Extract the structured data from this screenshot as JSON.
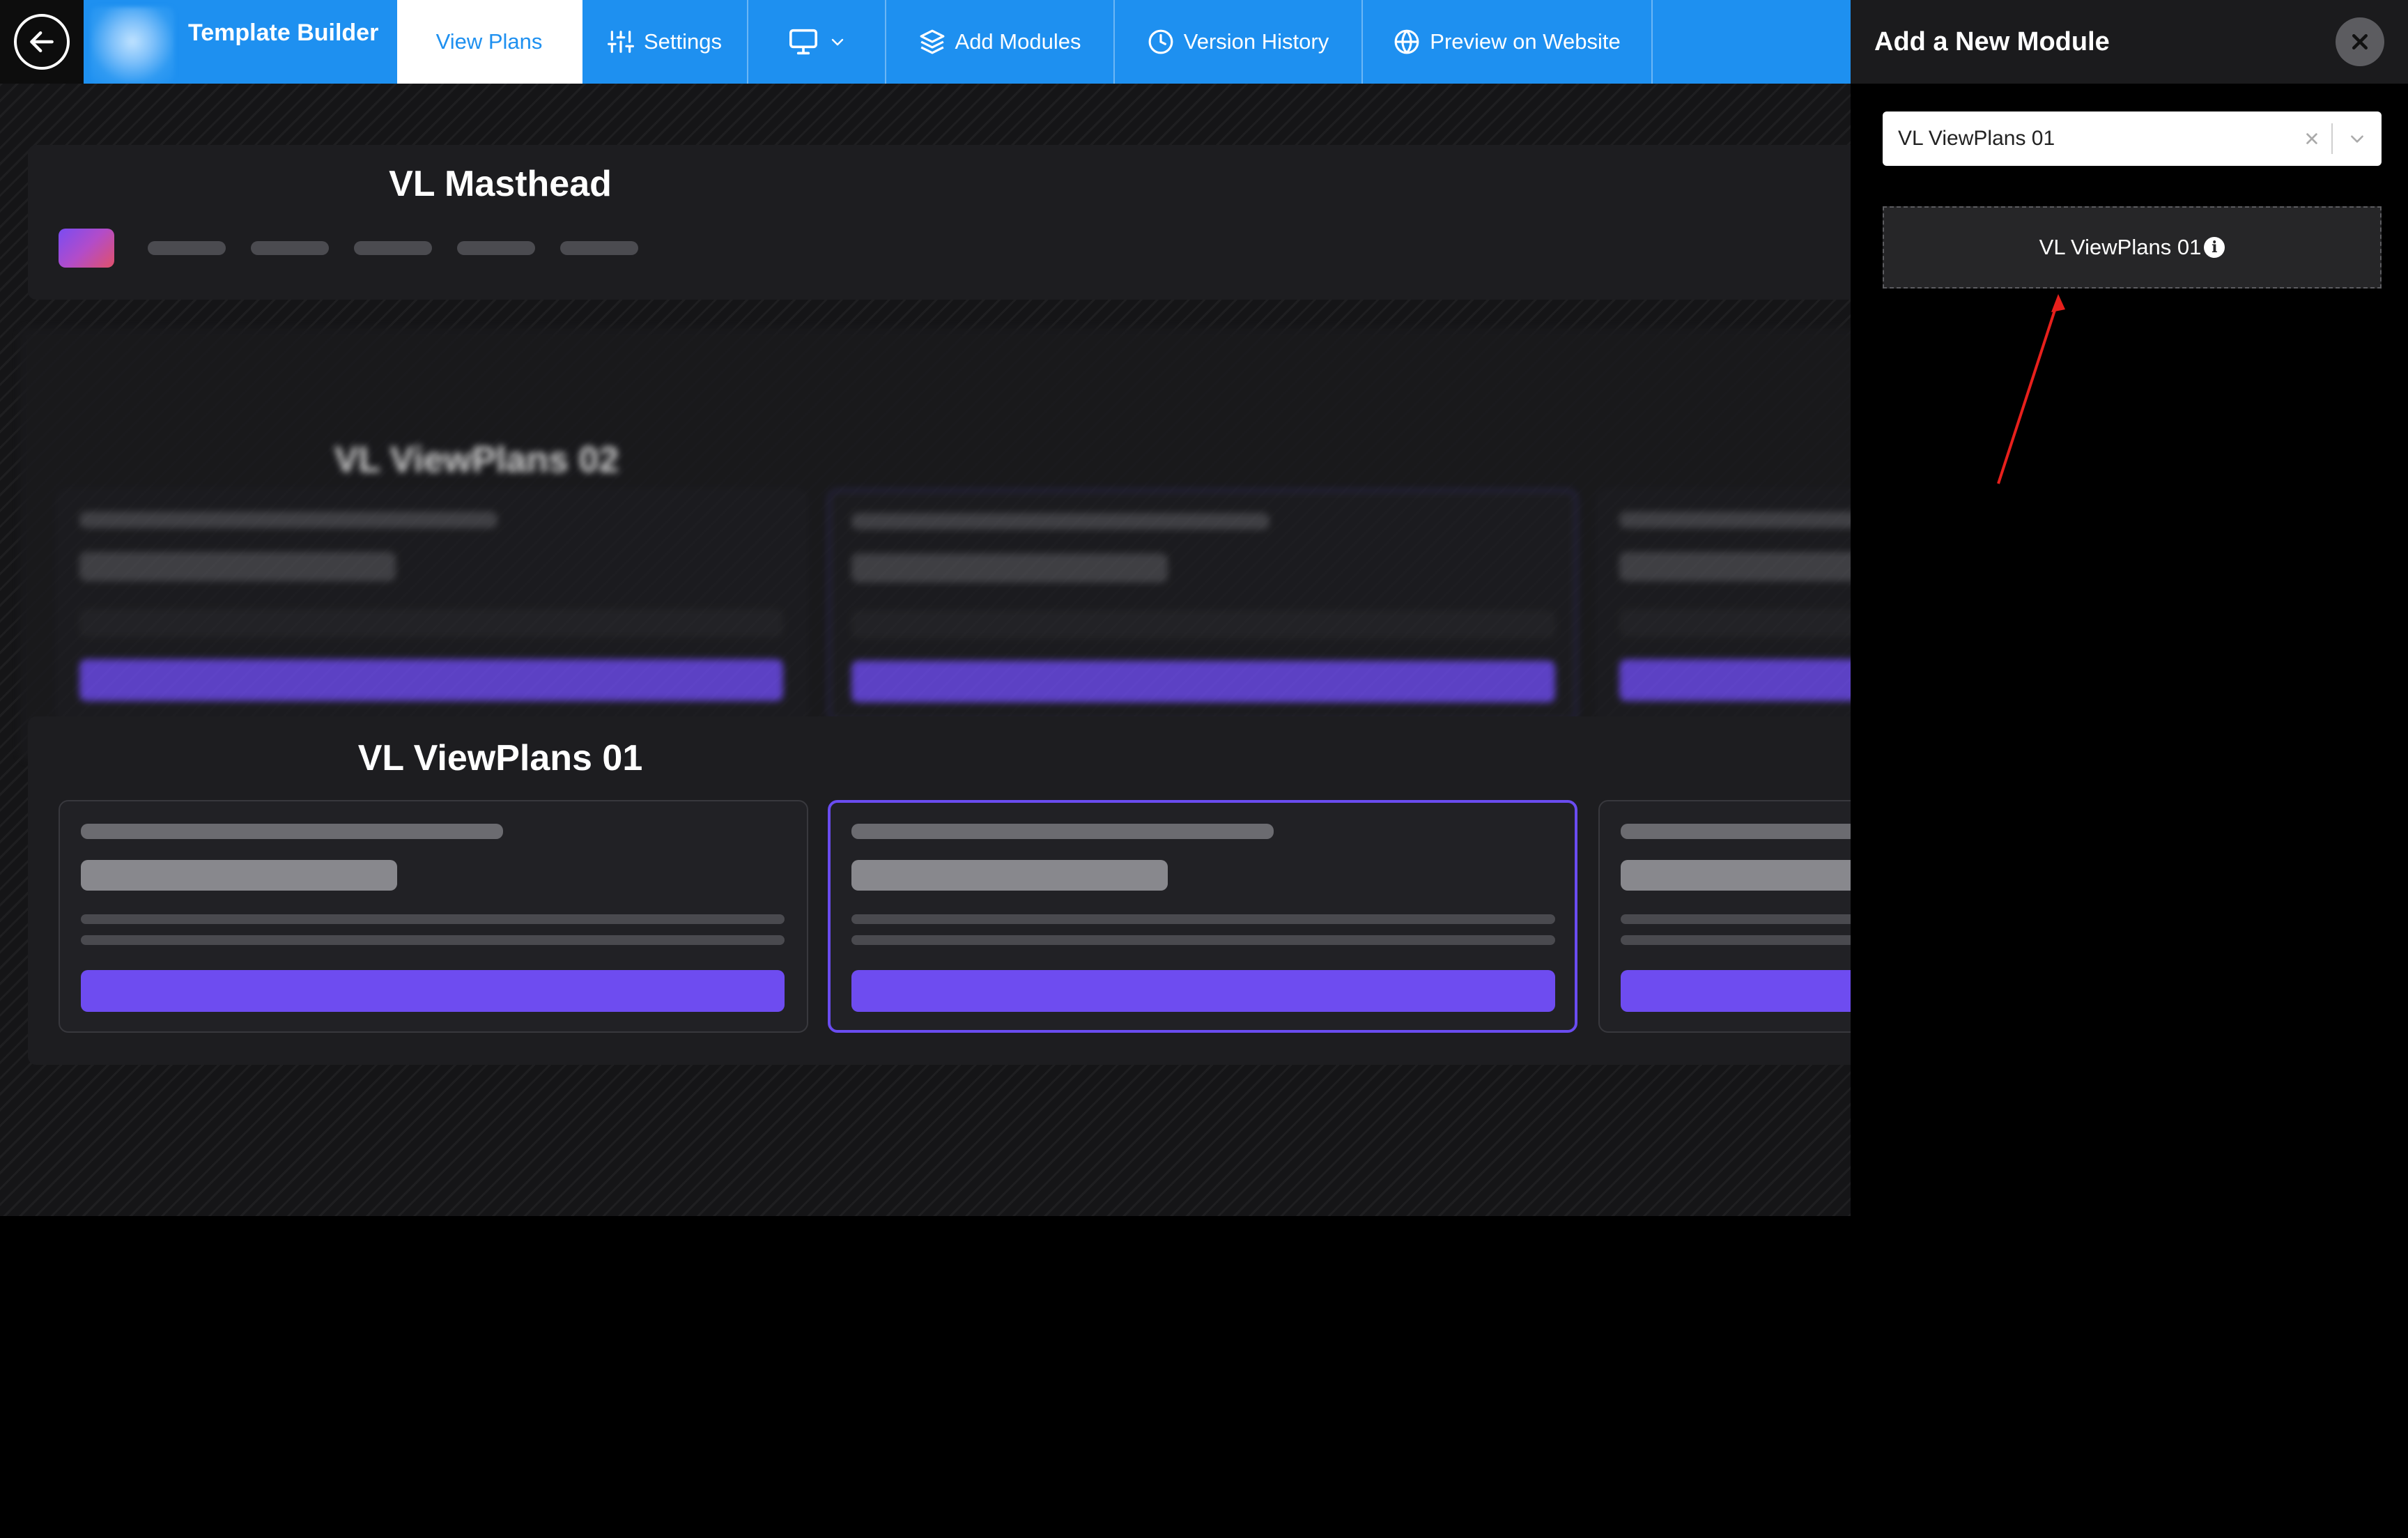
{
  "header": {
    "title": "Template Builder",
    "tabs": [
      {
        "label": "View Plans",
        "active": true
      },
      {
        "label": "Settings",
        "icon": "sliders-icon"
      },
      {
        "label": "",
        "icon": "monitor-icon"
      },
      {
        "label": "Add Modules",
        "icon": "layers-icon"
      },
      {
        "label": "Version History",
        "icon": "clock-icon"
      },
      {
        "label": "Preview on Website",
        "icon": "globe-icon"
      }
    ]
  },
  "canvas": {
    "modules": [
      {
        "title": "VL Masthead"
      },
      {
        "title": "VL ViewPlans 02"
      },
      {
        "title": "VL ViewPlans 01"
      }
    ]
  },
  "panel": {
    "title": "Add a New Module",
    "select_value": "VL ViewPlans 01",
    "option_label": "VL ViewPlans 01",
    "info_glyph": "i"
  },
  "colors": {
    "accent": "#1e90f0",
    "purple": "#6e4cf0",
    "annotation": "#e8201c"
  }
}
